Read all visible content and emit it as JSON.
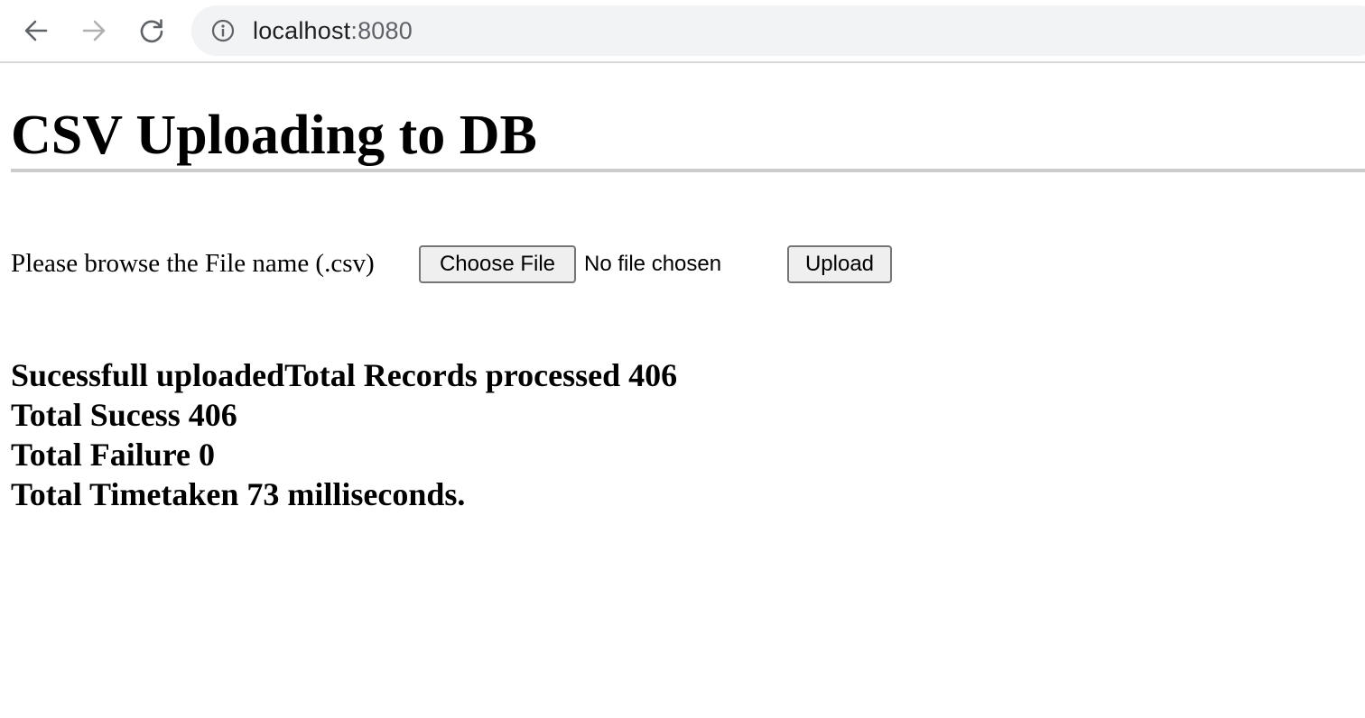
{
  "browser": {
    "url_host": "localhost",
    "url_port": ":8080",
    "icons": {
      "back": "arrow-left-icon",
      "forward": "arrow-right-icon",
      "reload": "reload-icon",
      "site_info": "info-icon"
    }
  },
  "page": {
    "title": "CSV Uploading to DB",
    "form": {
      "label": "Please browse the File name (.csv)",
      "choose_file_label": "Choose File",
      "no_file_text": "No file chosen",
      "upload_label": "Upload"
    },
    "results": [
      "Sucessfull uploadedTotal Records processed 406",
      "Total Sucess 406",
      "Total Failure 0",
      "Total Timetaken 73 milliseconds."
    ]
  },
  "colors": {
    "rule": "#cccccc",
    "address_bar_bg": "#f1f3f4",
    "button_bg": "#efefef"
  }
}
